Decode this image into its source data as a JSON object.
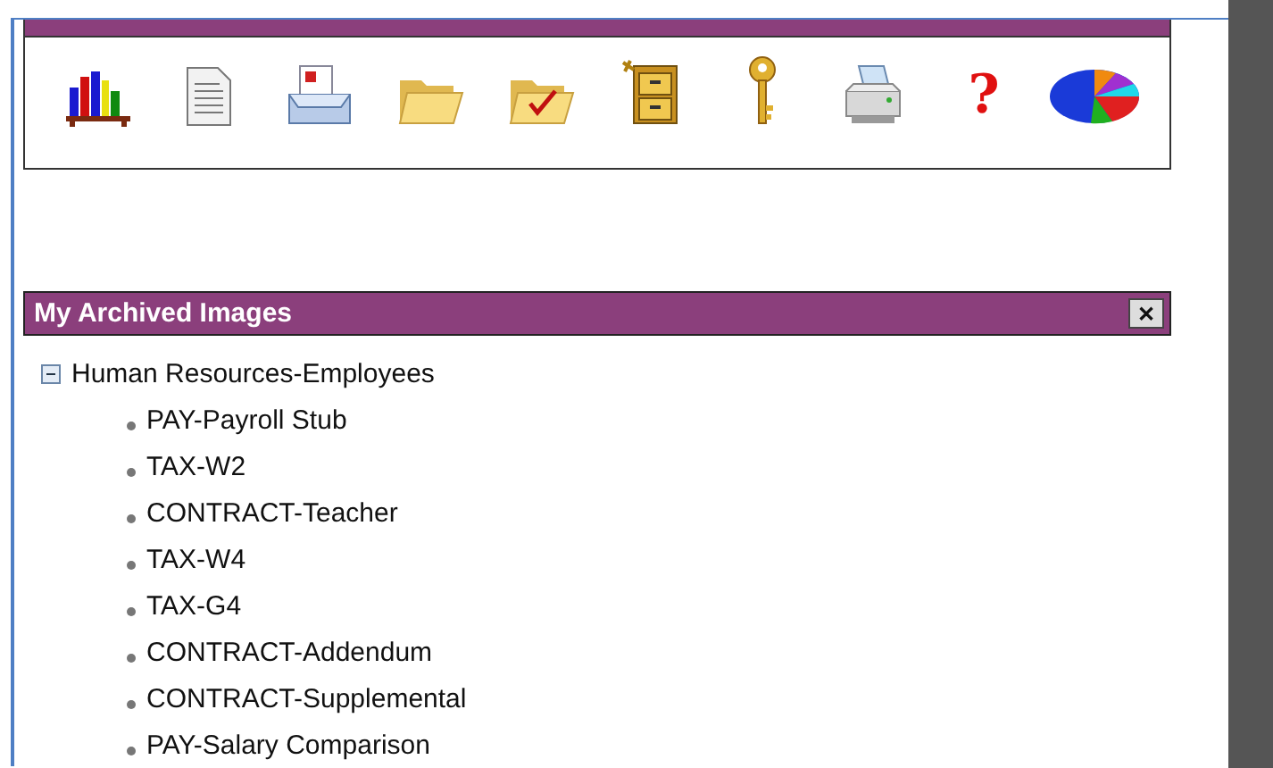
{
  "toolbar": [
    {
      "kind": "books"
    },
    {
      "kind": "document"
    },
    {
      "kind": "mailtray"
    },
    {
      "kind": "folder"
    },
    {
      "kind": "foldercheck"
    },
    {
      "kind": "cabinet"
    },
    {
      "kind": "key"
    },
    {
      "kind": "printer"
    },
    {
      "kind": "help",
      "glyph": "?"
    },
    {
      "kind": "pie"
    }
  ],
  "archive_panel": {
    "title": "My Archived Images",
    "close": "✕",
    "tree": [
      {
        "label": "Human Resources-Employees",
        "expanded": true,
        "children": [
          {
            "label": "PAY-Payroll Stub"
          },
          {
            "label": "TAX-W2"
          },
          {
            "label": "CONTRACT-Teacher"
          },
          {
            "label": "TAX-W4"
          },
          {
            "label": "TAX-G4"
          },
          {
            "label": "CONTRACT-Addendum"
          },
          {
            "label": "CONTRACT-Supplemental"
          },
          {
            "label": "PAY-Salary Comparison"
          }
        ]
      }
    ]
  }
}
